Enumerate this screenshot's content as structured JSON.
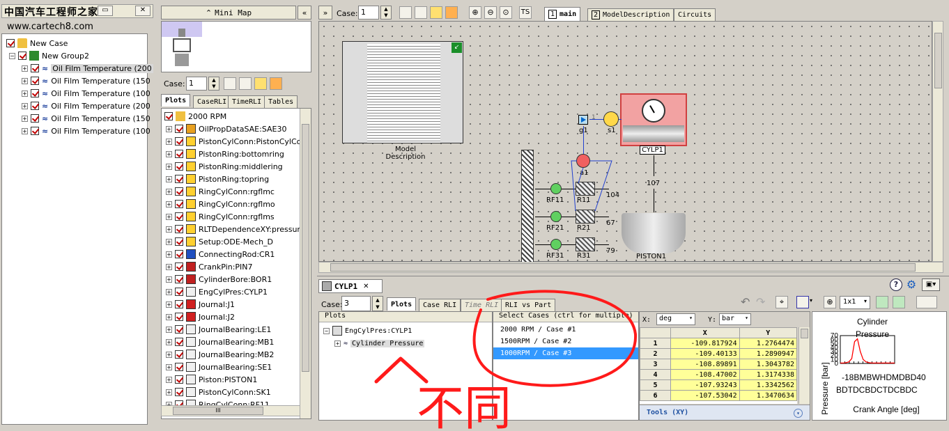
{
  "watermark": {
    "cn_title": "中国汽车工程师之家",
    "url": "www.cartech8.com"
  },
  "left_tree": {
    "root": "New Case",
    "group": "New Group2",
    "items": [
      "Oil Film Temperature (200",
      "Oil Film Temperature (150",
      "Oil Film Temperature (100",
      "Oil Film Temperature (200",
      "Oil Film Temperature (150",
      "Oil Film Temperature (100"
    ]
  },
  "minimap": {
    "button_label": "Mini Map",
    "collapse_label": "«"
  },
  "mid_panel": {
    "case_label": "Case:",
    "case_value": "1",
    "tabs": [
      "Plots",
      "CaseRLI",
      "TimeRLI",
      "Tables"
    ],
    "root": "2000 RPM",
    "items": [
      "OilPropDataSAE:SAE30",
      "PistonCylConn:PistonCylCon",
      "PistonRing:bottomring",
      "PistonRing:middlering",
      "PistonRing:topring",
      "RingCylConn:rgflmc",
      "RingCylConn:rgflmo",
      "RingCylConn:rgflms",
      "RLTDependenceXY:pressure",
      "Setup:ODE-Mech_D",
      "ConnectingRod:CR1",
      "CrankPin:PIN7",
      "CylinderBore:BOR1",
      "EngCylPres:CYLP1",
      "Journal:J1",
      "Journal:J2",
      "JournalBearing:LE1",
      "JournalBearing:MB1",
      "JournalBearing:MB2",
      "JournalBearing:SE1",
      "Piston:PISTON1",
      "PistonCylConn:SK1",
      "RingCylConn:RF11"
    ],
    "hscroll_label": "III"
  },
  "top_toolbar": {
    "case_label": "Case:",
    "case_value": "1",
    "tabs": [
      {
        "num": "1",
        "label": "main"
      },
      {
        "num": "2",
        "label": "ModelDescription"
      },
      {
        "num": "",
        "label": "Circuits"
      }
    ]
  },
  "canvas": {
    "model_desc_label": "Model\nDescription",
    "cylp_label": "CYLP1",
    "piston_label": "PISTON1",
    "g1": "g1",
    "s1": "s1",
    "a1": "a1",
    "n107": "107",
    "n104": "104",
    "n67": "67",
    "n79": "79",
    "rf11": "RF11",
    "rf21": "RF21",
    "rf31": "RF31",
    "r11": "R11",
    "r21": "R21",
    "r31": "R31",
    "num1": "1",
    "num2": "2"
  },
  "bottom": {
    "tab_title": "CYLP1",
    "case_label": "Case:",
    "case_value": "3",
    "tabs": [
      "Plots",
      "Case RLI",
      "Time RLI",
      "RLI vs Part"
    ],
    "plots_header": "Plots",
    "tree_root": "EngCylPres:CYLP1",
    "tree_child": "Cylinder Pressure",
    "select_header": "Select Cases (ctrl for multiple)",
    "cases": [
      "2000 RPM / Case #1",
      "1500RPM / Case #2",
      "1000RPM / Case #3"
    ],
    "x_label": "X:",
    "x_unit": "deg",
    "y_label": "Y:",
    "y_unit": "bar",
    "zoom_value": "1x1",
    "table_headers": [
      "X",
      "Y"
    ],
    "rows": [
      {
        "i": "1",
        "x": "-109.817924",
        "y": "1.2764474"
      },
      {
        "i": "2",
        "x": "-109.40133",
        "y": "1.2890947"
      },
      {
        "i": "3",
        "x": "-108.89891",
        "y": "1.3043782"
      },
      {
        "i": "4",
        "x": "-108.47002",
        "y": "1.3174338"
      },
      {
        "i": "5",
        "x": "-107.93243",
        "y": "1.3342562"
      },
      {
        "i": "6",
        "x": "-107.53042",
        "y": "1.3470634"
      }
    ],
    "tools_label": "Tools (XY)",
    "annotation_text": "不同"
  },
  "chart_data": {
    "type": "line",
    "title": "Cylinder Pressure",
    "xlabel": "Crank Angle [deg]",
    "ylabel": "Pressure [bar]",
    "yticks": [
      "70",
      "60",
      "50",
      "40",
      "30",
      "20",
      "10",
      "0"
    ],
    "xtick_text": "-180 BDC TDC BDC TDC BDC 540",
    "xtick_row1": "-18BMBWHDMDBD40",
    "xtick_row2": "BDTDCBDCTDCBDC",
    "ylim": [
      0,
      70
    ],
    "series": [
      {
        "values": [
          1,
          1,
          2,
          4,
          12,
          55,
          62,
          30,
          10,
          4,
          2,
          1,
          1,
          1,
          1,
          1,
          1,
          1,
          1,
          1
        ]
      }
    ],
    "line_color": "#ff0000"
  }
}
